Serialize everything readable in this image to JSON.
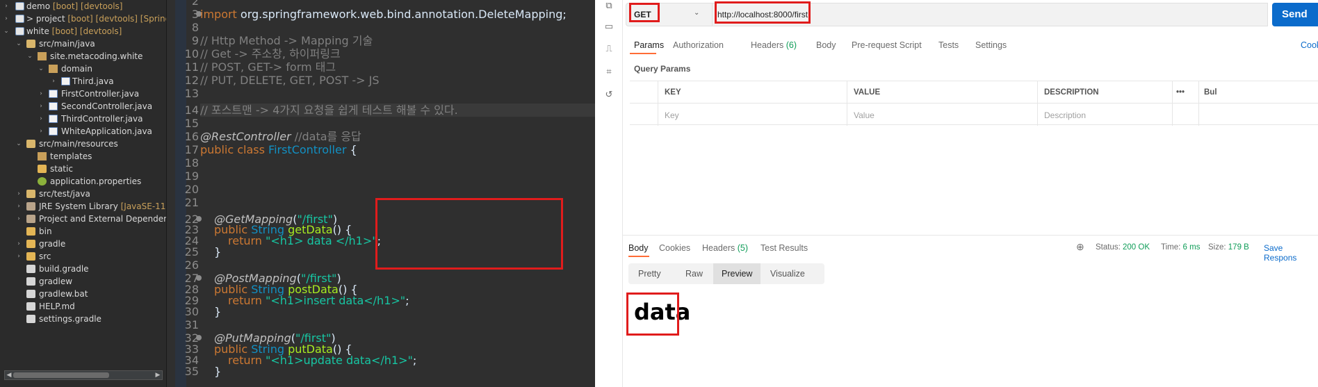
{
  "explorer": {
    "rows": [
      {
        "name": "demo",
        "decoration": " [boot] [devtools]",
        "arrow": "›"
      },
      {
        "name": "> project",
        "decoration": " [boot] [devtools] [Springbo",
        "arrow": "›"
      },
      {
        "name": "white",
        "decoration": " [boot] [devtools]",
        "arrow": "⌄"
      },
      {
        "name": "src/main/java",
        "decoration": "",
        "arrow": "⌄"
      },
      {
        "name": "site.metacoding.white",
        "decoration": "",
        "arrow": "⌄"
      },
      {
        "name": "domain",
        "decoration": "",
        "arrow": "⌄"
      },
      {
        "name": "Third.java",
        "decoration": "",
        "arrow": "›"
      },
      {
        "name": "FirstController.java",
        "decoration": "",
        "arrow": "›"
      },
      {
        "name": "SecondController.java",
        "decoration": "",
        "arrow": "›"
      },
      {
        "name": "ThirdController.java",
        "decoration": "",
        "arrow": "›"
      },
      {
        "name": "WhiteApplication.java",
        "decoration": "",
        "arrow": "›"
      },
      {
        "name": "src/main/resources",
        "decoration": "",
        "arrow": "⌄"
      },
      {
        "name": "templates",
        "decoration": "",
        "arrow": ""
      },
      {
        "name": "static",
        "decoration": "",
        "arrow": ""
      },
      {
        "name": "application.properties",
        "decoration": "",
        "arrow": ""
      },
      {
        "name": "src/test/java",
        "decoration": "",
        "arrow": "›"
      },
      {
        "name": "JRE System Library",
        "decoration": " [JavaSE-11]",
        "arrow": "›"
      },
      {
        "name": "Project and External Dependencie",
        "decoration": "",
        "arrow": "›"
      },
      {
        "name": "bin",
        "decoration": "",
        "arrow": ""
      },
      {
        "name": "gradle",
        "decoration": "",
        "arrow": "›"
      },
      {
        "name": "src",
        "decoration": "",
        "arrow": "›"
      },
      {
        "name": "build.gradle",
        "decoration": "",
        "arrow": ""
      },
      {
        "name": "gradlew",
        "decoration": "",
        "arrow": ""
      },
      {
        "name": "gradlew.bat",
        "decoration": "",
        "arrow": ""
      },
      {
        "name": "HELP.md",
        "decoration": "",
        "arrow": ""
      },
      {
        "name": "settings.gradle",
        "decoration": "",
        "arrow": ""
      }
    ]
  },
  "editor": {
    "lines": [
      {
        "n": "2"
      },
      {
        "n": "3",
        "imp_kw": "import",
        "imp_rest": " org.springframework.web.bind.annotation.DeleteMapping;"
      },
      {
        "n": "8"
      },
      {
        "n": "9",
        "comment": "// Http Method -> Mapping 기술"
      },
      {
        "n": "10",
        "comment": "// Get -> 주소창, 하이퍼링크"
      },
      {
        "n": "11",
        "comment": "// POST, GET-> form 태그"
      },
      {
        "n": "12",
        "comment": "// PUT, DELETE, GET, POST -> JS"
      },
      {
        "n": "13"
      },
      {
        "n": "14",
        "comment": "// 포스트맨 -> 4가지 요청을 쉽게 테스트 해볼 수 있다."
      },
      {
        "n": "15"
      },
      {
        "n": "16",
        "annot": "@RestController",
        "comment": " //data를 응답"
      },
      {
        "n": "17",
        "cls_kw": "public class ",
        "cls_name": "FirstController",
        "cls_rest": " {"
      },
      {
        "n": "18"
      },
      {
        "n": "19"
      },
      {
        "n": "20"
      },
      {
        "n": "21"
      },
      {
        "n": "22",
        "annot": "@GetMapping",
        "p1": "(",
        "str": "\"/first\"",
        "p2": ")"
      },
      {
        "n": "23",
        "kw": "public ",
        "type": "String ",
        "method": "getData",
        "rest": "() {"
      },
      {
        "n": "24",
        "kw": "return ",
        "str": "\"<h1> data </h1>\"",
        "rest": ";"
      },
      {
        "n": "25",
        "rest": "}"
      },
      {
        "n": "26"
      },
      {
        "n": "27",
        "annot": "@PostMapping",
        "p1": "(",
        "str": "\"/first\"",
        "p2": ")"
      },
      {
        "n": "28",
        "kw": "public ",
        "type": "String ",
        "method": "postData",
        "rest": "() {"
      },
      {
        "n": "29",
        "kw": "return ",
        "str": "\"<h1>insert data</h1>\"",
        "rest": ";"
      },
      {
        "n": "30",
        "rest": "}"
      },
      {
        "n": "31"
      },
      {
        "n": "32",
        "annot": "@PutMapping",
        "p1": "(",
        "str": "\"/first\"",
        "p2": ")"
      },
      {
        "n": "33",
        "kw": "public ",
        "type": "String ",
        "method": "putData",
        "rest": "() {"
      },
      {
        "n": "34",
        "kw": "return ",
        "str": "\"<h1>update data</h1>\"",
        "rest": ";"
      },
      {
        "n": "35",
        "rest": "}"
      }
    ]
  },
  "postman": {
    "method": "GET",
    "url": "http://localhost:8000/first",
    "send_label": "Send",
    "req_tabs": {
      "params": "Params",
      "authorization": "Authorization",
      "headers": "Headers",
      "headers_count": "(6)",
      "body": "Body",
      "prerequest": "Pre-request Script",
      "tests": "Tests",
      "settings": "Settings"
    },
    "cookies_link": "Cooki",
    "query_params_title": "Query Params",
    "table": {
      "col_key": "KEY",
      "col_value": "VALUE",
      "col_description": "DESCRIPTION",
      "more": "•••",
      "bulk": "Bul",
      "ph_key": "Key",
      "ph_value": "Value",
      "ph_description": "Description"
    },
    "resp_tabs": {
      "body": "Body",
      "cookies": "Cookies",
      "headers": "Headers",
      "headers_count": "(5)",
      "test_results": "Test Results"
    },
    "status": {
      "status_label": "Status:",
      "status_value": "200 OK",
      "time_label": "Time:",
      "time_value": "6 ms",
      "size_label": "Size:",
      "size_value": "179 B"
    },
    "save_response": "Save Respons",
    "view_tabs": {
      "pretty": "Pretty",
      "raw": "Raw",
      "preview": "Preview",
      "visualize": "Visualize"
    },
    "preview_text": "data"
  }
}
